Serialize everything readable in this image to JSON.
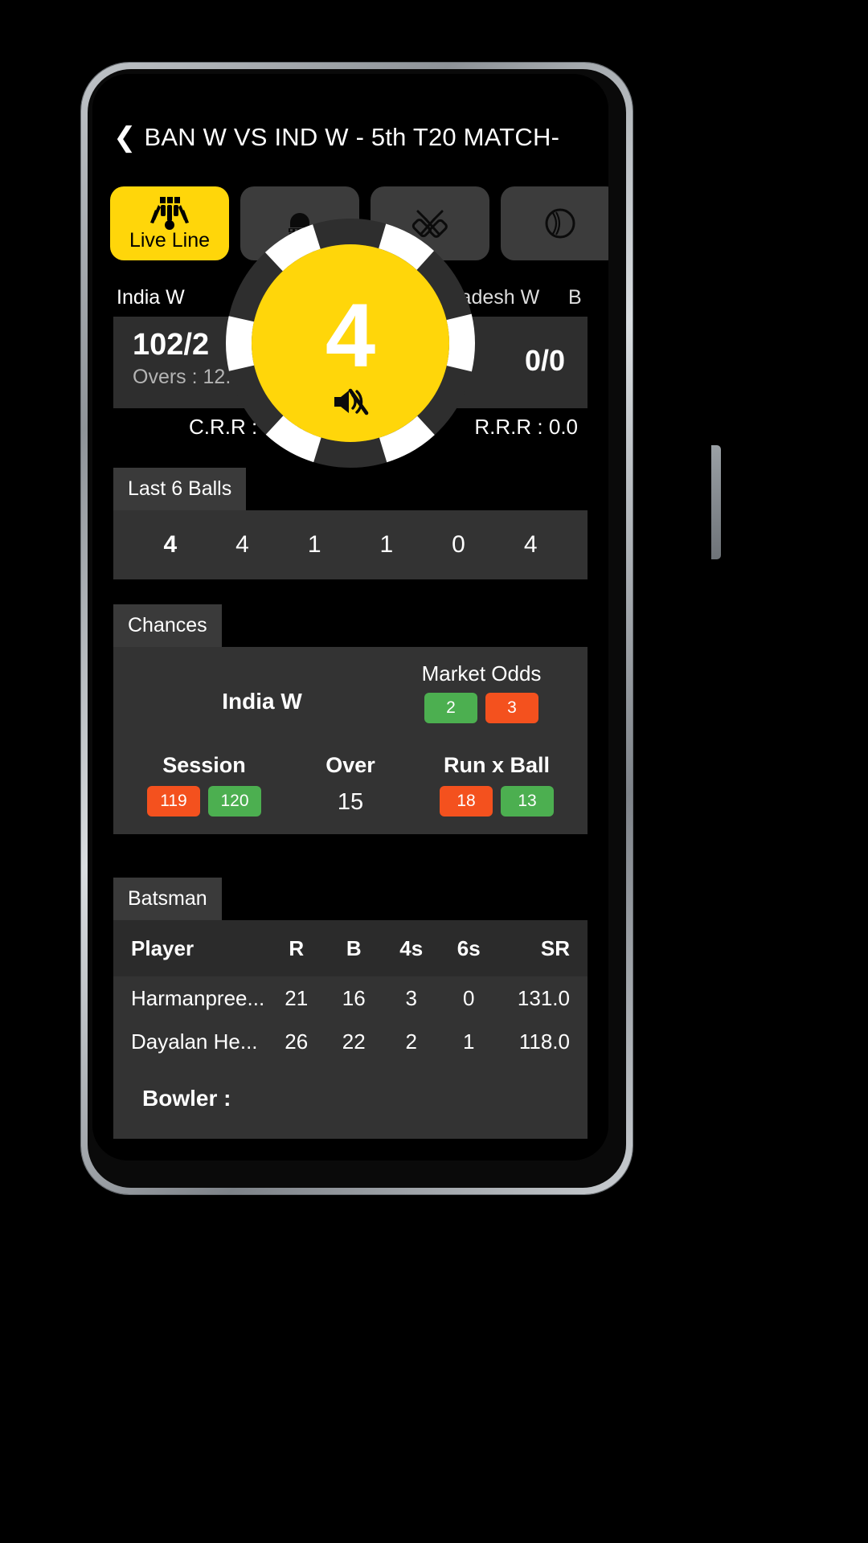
{
  "header": {
    "back_icon": "chevron-left-icon",
    "title": "BAN W VS IND W - 5th T20 MATCH-"
  },
  "tabs": [
    {
      "label": "Live Line",
      "icon": "stumps-bails-icon",
      "active": true
    },
    {
      "label": "",
      "icon": "helmet-icon",
      "active": false
    },
    {
      "label": "",
      "icon": "crossed-bats-icon",
      "active": false
    },
    {
      "label": "",
      "icon": "cricket-ball-icon",
      "active": false
    }
  ],
  "teams": {
    "left_name": "India W",
    "left_flag": "india-flag-icon",
    "right_flag": "bangladesh-flag-icon",
    "right_name": "ladesh W",
    "right_name_extra": "B"
  },
  "score": {
    "left_runs": "102/2",
    "left_overs": "Overs : 12.5",
    "right_runs": "0/0",
    "crr": "C.R.R : 8.16",
    "rrr": "R.R.R : 0.0"
  },
  "ball_overlay": {
    "value": "4",
    "mute_icon": "volume-muted-icon",
    "ring_color": "#2e2e2e",
    "ball_color": "#ffd60a"
  },
  "last_six_balls": {
    "title": "Last 6 Balls",
    "balls": [
      "4",
      "4",
      "1",
      "1",
      "0",
      "4"
    ]
  },
  "chances": {
    "title": "Chances",
    "team": "India W",
    "market_label": "Market Odds",
    "market_back": "2",
    "market_lay": "3",
    "session_title": "Session",
    "session_no": "119",
    "session_yes": "120",
    "over_title": "Over",
    "over_value": "15",
    "runxball_title": "Run x Ball",
    "runxball_no": "18",
    "runxball_yes": "13"
  },
  "batsman": {
    "title": "Batsman",
    "columns": [
      "Player",
      "R",
      "B",
      "4s",
      "6s",
      "SR"
    ],
    "rows": [
      {
        "player": "Harmanpree...",
        "r": "21",
        "b": "16",
        "fours": "3",
        "sixes": "0",
        "sr": "131.0"
      },
      {
        "player": "Dayalan He...",
        "r": "26",
        "b": "22",
        "fours": "2",
        "sixes": "1",
        "sr": "118.0"
      }
    ],
    "bowler_label": "Bowler :"
  },
  "colors": {
    "accent_yellow": "#ffd60a",
    "green": "#4caf50",
    "orange": "#f4511e",
    "card_bg": "#333333",
    "tab_bg": "#3c3c3c"
  }
}
